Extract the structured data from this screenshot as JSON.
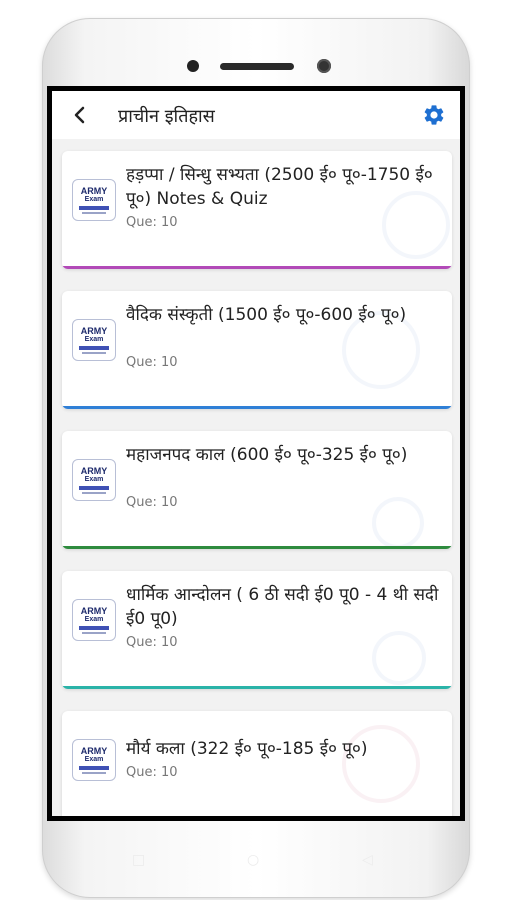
{
  "header": {
    "title": "प्राचीन इतिहास",
    "back_icon": "back-arrow-icon",
    "settings_icon": "gear-icon"
  },
  "accent_color": "#1e6fd1",
  "logo": {
    "line1": "ARMY",
    "line2": "Exam"
  },
  "cards": [
    {
      "title": "हड़प्पा / सिन्धु सभ्यता (2500 ई० पू०-1750 ई० पू०) Notes & Quiz",
      "que": "Que: 10",
      "bar_color": "#b24ab8"
    },
    {
      "title": "वैदिक संस्कृती (1500 ई० पू०-600 ई० पू०)",
      "que": "Que: 10",
      "bar_color": "#2f7fd6"
    },
    {
      "title": "महाजनपद काल (600 ई० पू०-325 ई० पू०)",
      "que": "Que: 10",
      "bar_color": "#2e8b3e"
    },
    {
      "title": "धार्मिक आन्दोलन ( 6 ठी सदी ई0 पू0 - 4 थी सदी ई0 पू0)",
      "que": "Que: 10",
      "bar_color": "#2bb3a8"
    },
    {
      "title": "मौर्य कला (322 ई० पू०-185 ई० पू०)",
      "que": "Que: 10",
      "bar_color": "#d04a4a"
    }
  ],
  "nav": {
    "recent_glyph": "□",
    "home_glyph": "○",
    "back_glyph": "◁"
  }
}
